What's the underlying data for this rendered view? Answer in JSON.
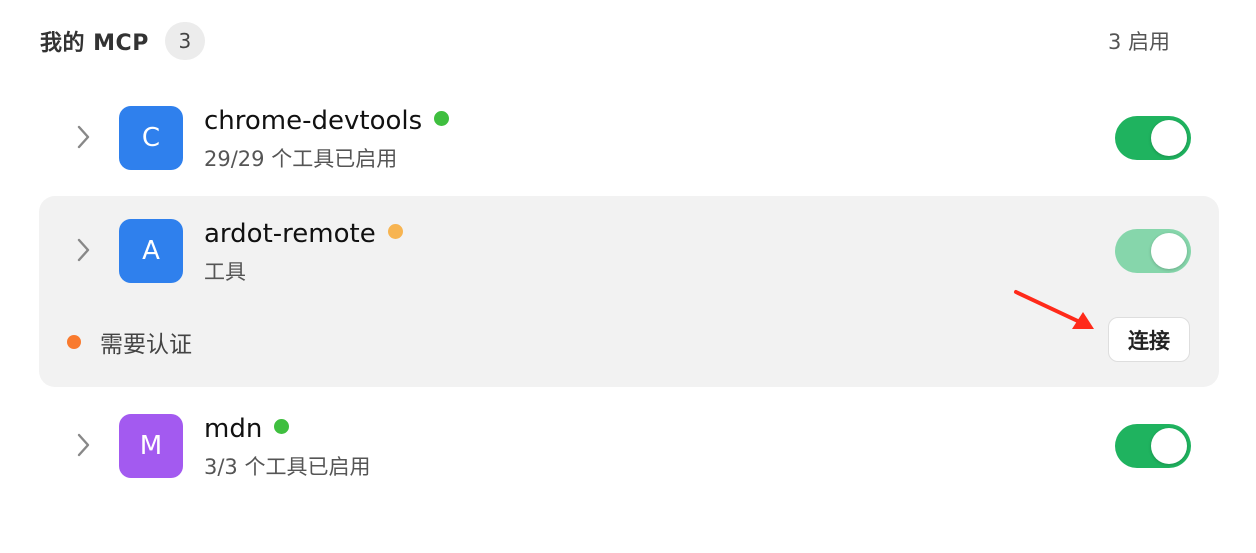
{
  "header": {
    "title": "我的 MCP",
    "count": "3",
    "enabled_summary": "3 启用"
  },
  "servers": [
    {
      "initial": "C",
      "name": "chrome-devtools",
      "subtitle": "29/29 个工具已启用",
      "avatar_color": "#2f80ed",
      "status_color": "#3fbf3f",
      "enabled": true,
      "toggle_color": "#1fb35f"
    },
    {
      "initial": "A",
      "name": "ardot-remote",
      "subtitle": "工具",
      "avatar_color": "#2f80ed",
      "status_color": "#f7b451",
      "enabled": true,
      "toggle_color": "#86d6ab",
      "auth_text": "需要认证",
      "auth_dot_color": "#f97a2e",
      "connect_label": "连接"
    },
    {
      "initial": "M",
      "name": "mdn",
      "subtitle": "3/3 个工具已启用",
      "avatar_color": "#a35af0",
      "status_color": "#3fbf3f",
      "enabled": true,
      "toggle_color": "#1fb35f"
    }
  ],
  "annotation": {
    "arrow_color": "#ff2a1a"
  }
}
